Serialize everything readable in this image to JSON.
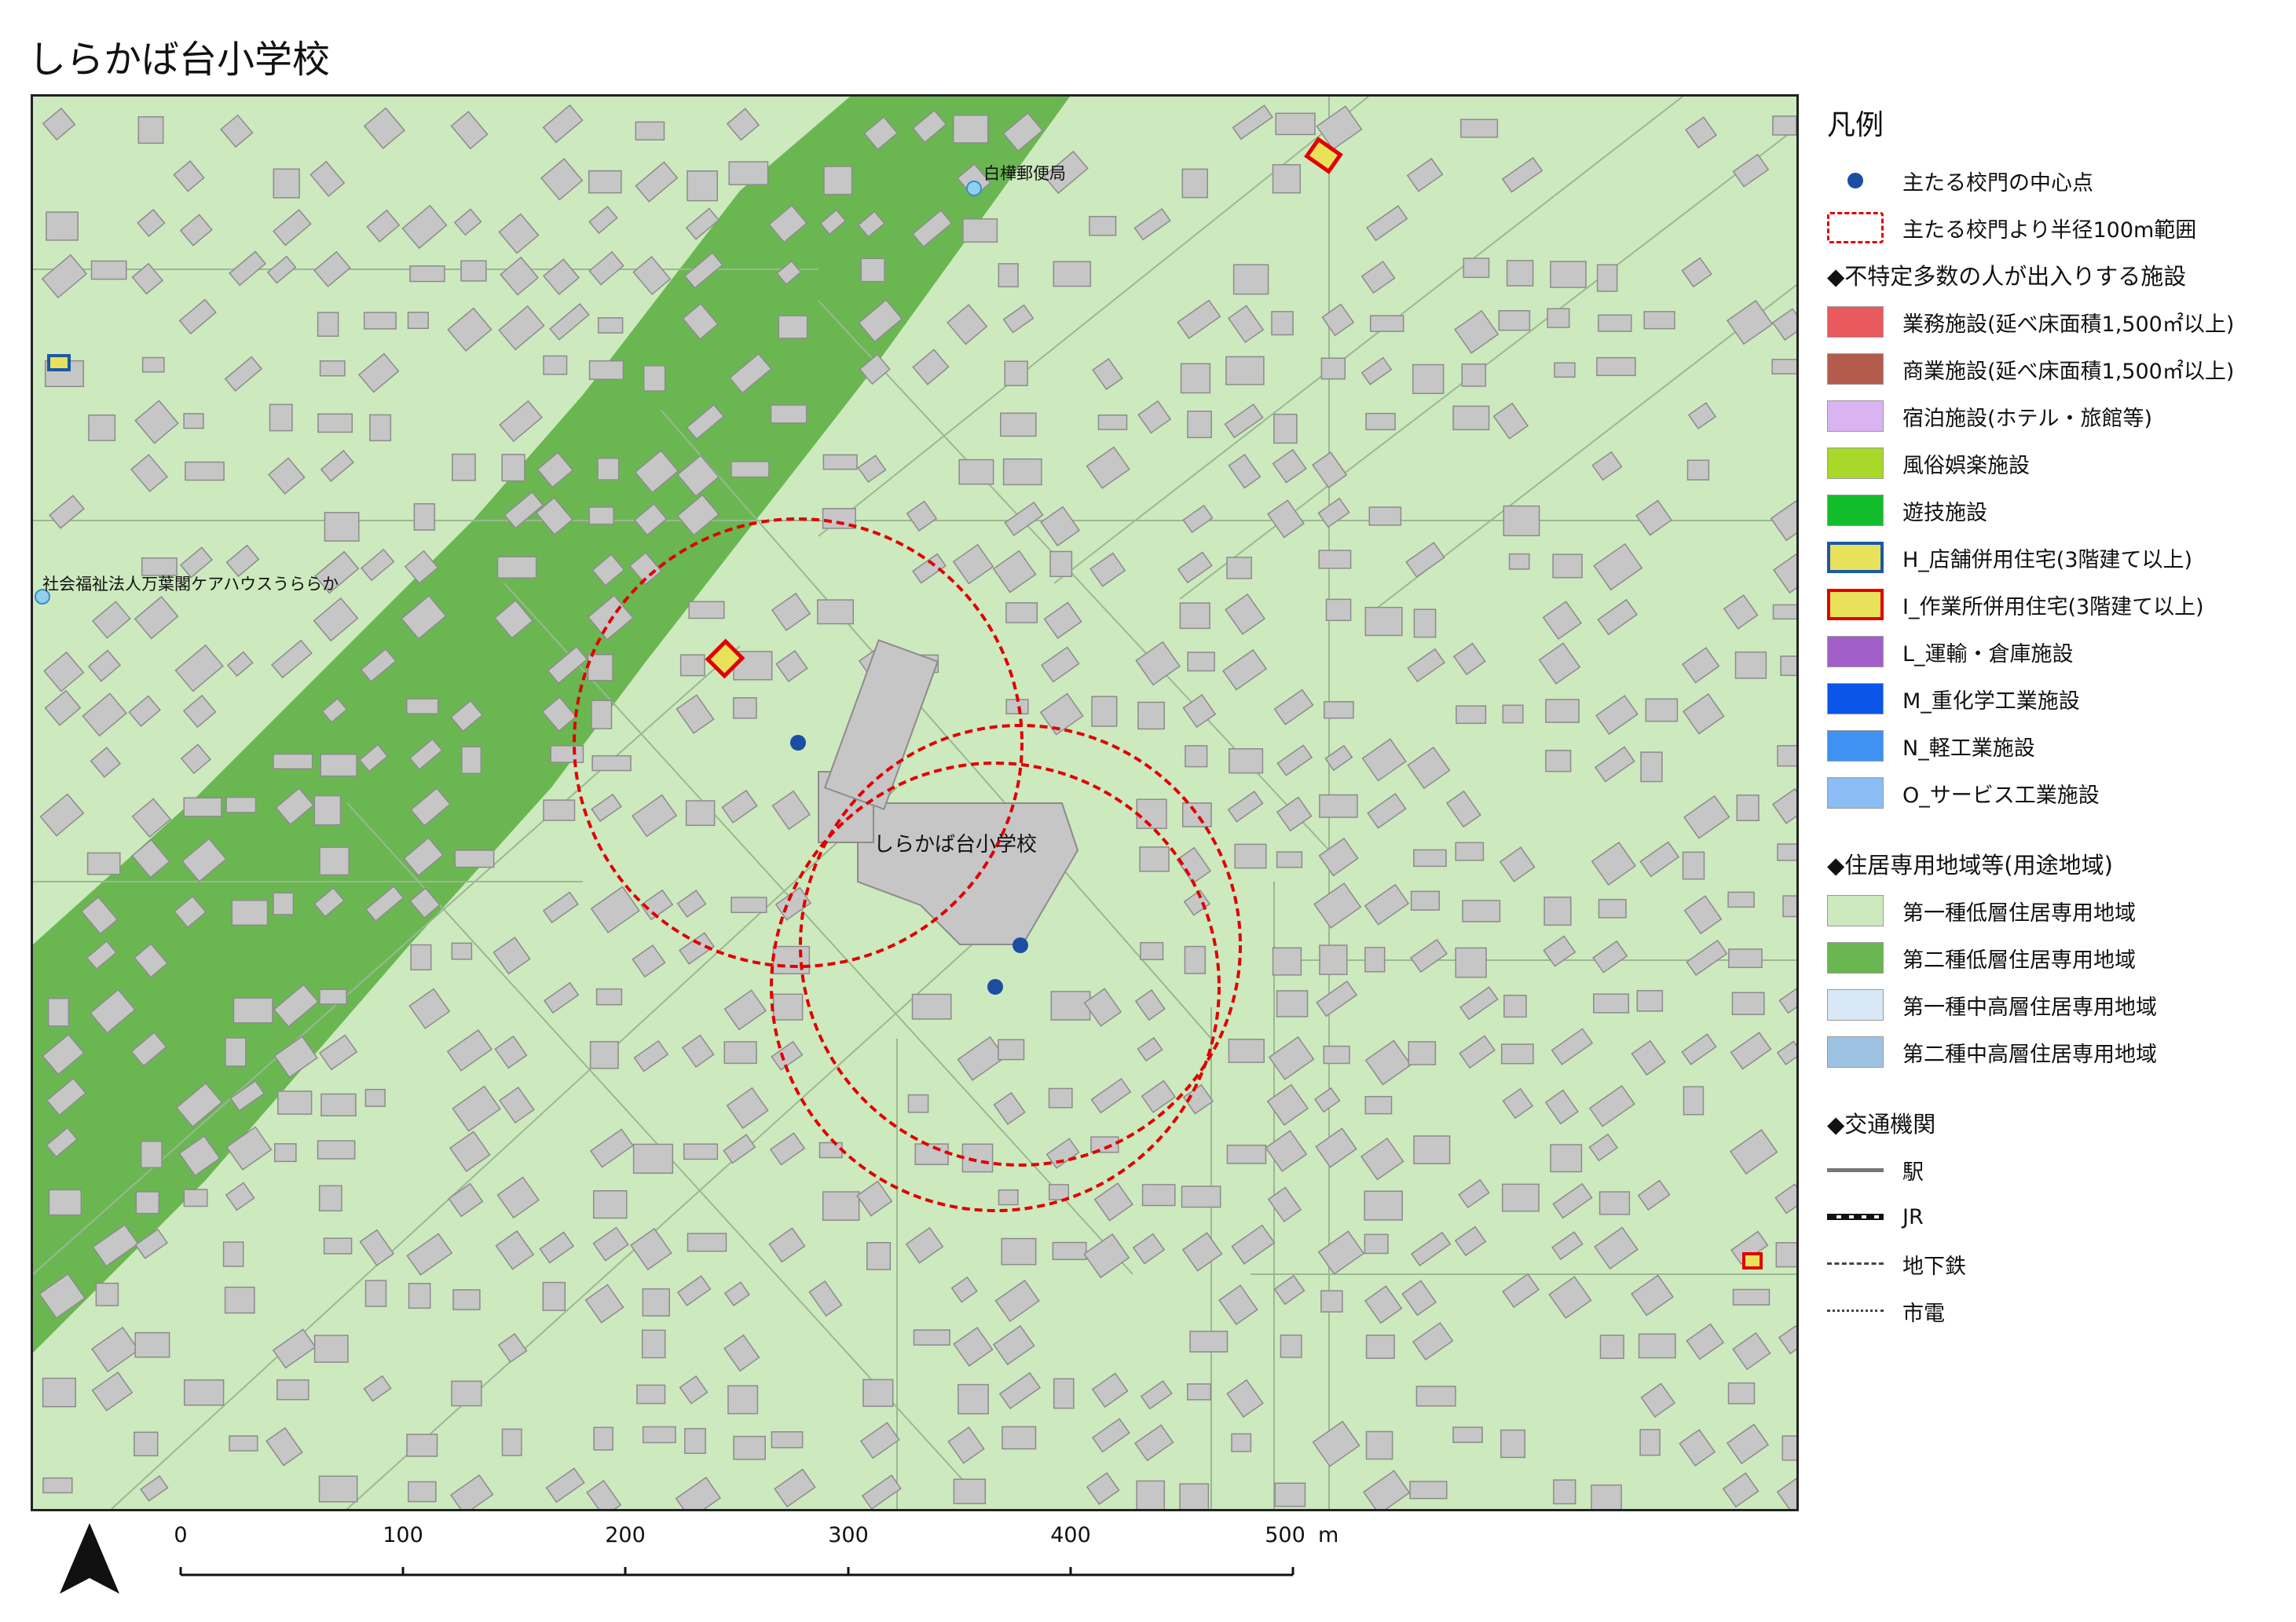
{
  "title": "しらかば台小学校",
  "map": {
    "labels": {
      "post_office": "白樺郵便局",
      "care_house": "社会福祉法人万葉閣ケアハウスうららか",
      "school": "しらかば台小学校"
    },
    "colors": {
      "zone1_low_residential": "#cde9be",
      "zone2_low_residential": "#6ab752",
      "building": "#c6c6c6",
      "building_outline": "#8c8c8c",
      "road_outline": "#9bb893",
      "gate_point": "#1b4ea3",
      "radius_circle": "#e00000",
      "facility_post_icon": "#8fd0f0"
    }
  },
  "legend": {
    "title": "凡例",
    "items_top": [
      {
        "label": "主たる校門の中心点",
        "symbol": "dot"
      },
      {
        "label": "主たる校門より半径100m範囲",
        "symbol": "dashbox"
      }
    ],
    "facilities_heading": "◆不特定多数の人が出入りする施設",
    "facilities": [
      {
        "label": "業務施設(延べ床面積1,500㎡以上)",
        "fill": "#e85a5e",
        "border": "#9a9a9a"
      },
      {
        "label": "商業施設(延べ床面積1,500㎡以上)",
        "fill": "#b35b4c",
        "border": "#9a9a9a"
      },
      {
        "label": "宿泊施設(ホテル・旅館等)",
        "fill": "#d9b3f2",
        "border": "#9a9a9a"
      },
      {
        "label": "風俗娯楽施設",
        "fill": "#a8d82a",
        "border": "#9a9a9a"
      },
      {
        "label": "遊技施設",
        "fill": "#12bd2b",
        "border": "#9a9a9a"
      },
      {
        "label": "H_店舗併用住宅(3階建て以上)",
        "fill": "#e8e25a",
        "border": "#1a5aa8"
      },
      {
        "label": "I_作業所併用住宅(3階建て以上)",
        "fill": "#e8e25a",
        "border": "#e00000"
      },
      {
        "label": "L_運輸・倉庫施設",
        "fill": "#a25fc9",
        "border": "#9a9a9a"
      },
      {
        "label": "M_重化学工業施設",
        "fill": "#0b55e8",
        "border": "#9a9a9a"
      },
      {
        "label": "N_軽工業施設",
        "fill": "#3f92f2",
        "border": "#9a9a9a"
      },
      {
        "label": "O_サービス工業施設",
        "fill": "#8bbcf3",
        "border": "#9a9a9a"
      }
    ],
    "zones_heading": "◆住居専用地域等(用途地域)",
    "zones": [
      {
        "label": "第一種低層住居専用地域",
        "fill": "#cde9be",
        "border": "#9a9a9a"
      },
      {
        "label": "第二種低層住居専用地域",
        "fill": "#6ab752",
        "border": "#9a9a9a"
      },
      {
        "label": "第一種中高層住居専用地域",
        "fill": "#d9e8f6",
        "border": "#9a9a9a"
      },
      {
        "label": "第二種中高層住居専用地域",
        "fill": "#9ec2e2",
        "border": "#9a9a9a"
      }
    ],
    "transport_heading": "◆交通機関",
    "transport": [
      {
        "label": "駅",
        "symbol": "station"
      },
      {
        "label": "JR",
        "symbol": "jr"
      },
      {
        "label": "地下鉄",
        "symbol": "subway"
      },
      {
        "label": "市電",
        "symbol": "tram"
      }
    ]
  },
  "scalebar": {
    "ticks": [
      "0",
      "100",
      "200",
      "300",
      "400",
      "500"
    ],
    "unit": "m"
  }
}
